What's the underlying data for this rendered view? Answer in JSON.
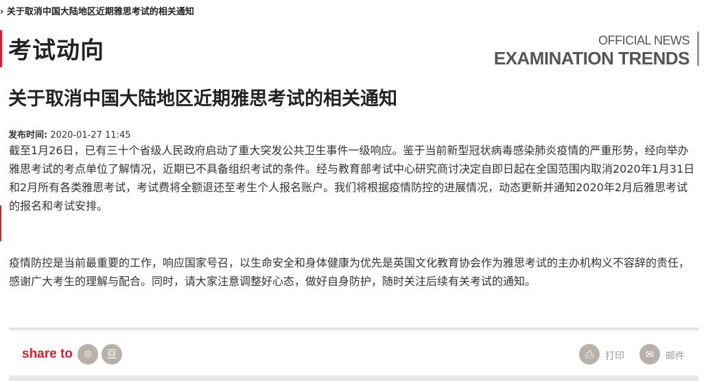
{
  "breadcrumb": {
    "text": "› 关于取消中国大陆地区近期雅思考试的相关通知"
  },
  "section": {
    "title": "考试动向",
    "en_small": "OFFICIAL NEWS",
    "en_big": "EXAMINATION TRENDS"
  },
  "article": {
    "title": "关于取消中国大陆地区近期雅思考试的相关通知",
    "publish_label": "发布时间:",
    "publish_time": "2020-01-27 11:45",
    "paragraphs": [
      "截至1月26日，已有三十个省级人民政府启动了重大突发公共卫生事件一级响应。鉴于当前新型冠状病毒感染肺炎疫情的严重形势，经向举办雅思考试的考点单位了解情况，近期已不具备组织考试的条件。经与教育部考试中心研究商讨决定自即日起在全国范围内取消2020年1月31日和2月所有各类雅思考试，考试费将全额退还至考生个人报名账户。我们将根据疫情防控的进展情况，动态更新并通知2020年2月后雅思考试的报名和考试安排。",
      "疫情防控是当前最重要的工作，响应国家号召，以生命安全和身体健康为优先是英国文化教育协会作为雅思考试的主办机构义不容辞的责任，感谢广大考生的理解与配合。同时，请大家注意调整好心态，做好自身防护，随时关注后续有关考试的通知。"
    ]
  },
  "share": {
    "label": "share to",
    "weibo_icon": "weibo-icon",
    "weibo_glyph": "◎",
    "douban_icon": "douban-icon",
    "douban_glyph": "豆"
  },
  "actions": {
    "print_label": "打印",
    "print_icon": "printer-icon",
    "print_glyph": "⎙",
    "mail_label": "邮件",
    "mail_icon": "mail-icon",
    "mail_glyph": "✉"
  },
  "colors": {
    "accent": "#d2202f",
    "icon_bg": "#b8b1aa",
    "muted_text": "#999999"
  }
}
